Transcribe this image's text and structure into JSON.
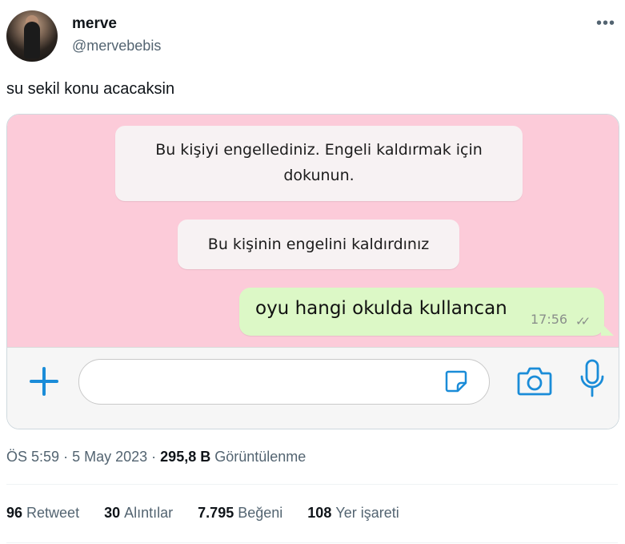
{
  "author": {
    "name": "merve",
    "handle": "@mervebebis"
  },
  "tweet": {
    "text": "su sekil konu acacaksin"
  },
  "chat": {
    "system_msg_1_line1": "Bu kişiyi engellediniz. Engeli kaldırmak için",
    "system_msg_1_line2": "dokunun.",
    "system_msg_2": "Bu kişinin engelini kaldırdınız",
    "outgoing_text": "oyu hangi okulda kullancan",
    "outgoing_time": "17:56",
    "colors": {
      "chat_bg": "#fccbd9",
      "outgoing_bubble": "#dcf8c6",
      "icon_blue": "#1a8cd8"
    },
    "icons": [
      "plus-icon",
      "sticker-icon",
      "camera-icon",
      "microphone-icon"
    ]
  },
  "meta": {
    "time": "ÖS 5:59",
    "separator": "·",
    "date": "5 May 2023",
    "views_count": "295,8 B",
    "views_label": "Görüntülenme"
  },
  "stats": {
    "retweets_count": "96",
    "retweets_label": "Retweet",
    "quotes_count": "30",
    "quotes_label": "Alıntılar",
    "likes_count": "7.795",
    "likes_label": "Beğeni",
    "bookmarks_count": "108",
    "bookmarks_label": "Yer işareti"
  }
}
